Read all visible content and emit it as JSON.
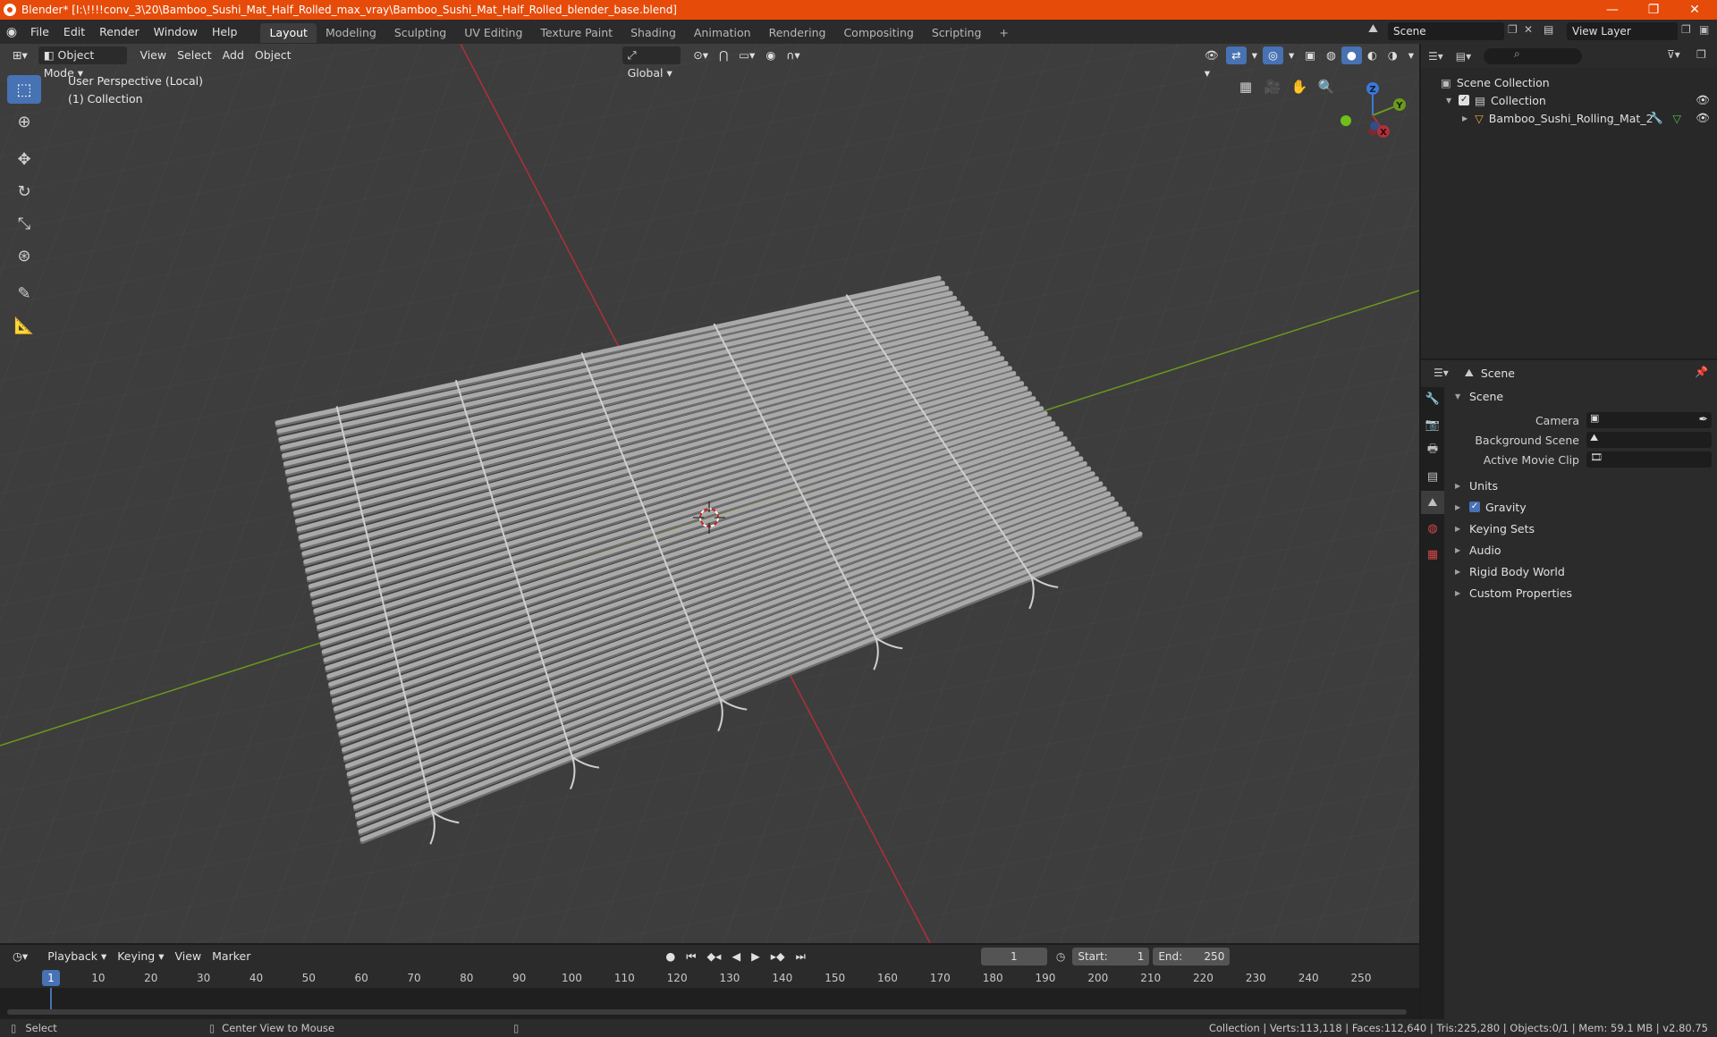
{
  "window": {
    "title": "Blender* [I:\\!!!!conv_3\\20\\Bamboo_Sushi_Mat_Half_Rolled_max_vray\\Bamboo_Sushi_Mat_Half_Rolled_blender_base.blend]",
    "controls": {
      "minimize": "—",
      "maximize": "❐",
      "close": "✕"
    }
  },
  "menu": [
    "File",
    "Edit",
    "Render",
    "Window",
    "Help"
  ],
  "workspaces": [
    "Layout",
    "Modeling",
    "Sculpting",
    "UV Editing",
    "Texture Paint",
    "Shading",
    "Animation",
    "Rendering",
    "Compositing",
    "Scripting"
  ],
  "workspace_add": "+",
  "scene_selector": {
    "value": "Scene"
  },
  "view_layer_selector": {
    "value": "View Layer"
  },
  "viewport": {
    "mode": "Object Mode",
    "menus": [
      "View",
      "Select",
      "Add",
      "Object"
    ],
    "orientation": "Global",
    "info_line1": "User Perspective (Local)",
    "info_line2": "(1) Collection",
    "gizmo_axes": {
      "x": "X",
      "y": "Y",
      "z": "Z"
    }
  },
  "outliner": {
    "search_placeholder": "",
    "scene_collection": "Scene Collection",
    "collection": "Collection",
    "object": "Bamboo_Sushi_Rolling_Mat_2"
  },
  "properties": {
    "header": "Scene",
    "panel": "Scene",
    "fields": [
      {
        "label": "Camera",
        "value": ""
      },
      {
        "label": "Background Scene",
        "value": ""
      },
      {
        "label": "Active Movie Clip",
        "value": ""
      }
    ],
    "subpanels": [
      "Units",
      "Gravity",
      "Keying Sets",
      "Audio",
      "Rigid Body World",
      "Custom Properties"
    ],
    "gravity_checked": true
  },
  "timeline": {
    "menus": [
      "Playback",
      "Keying",
      "View",
      "Marker"
    ],
    "current_frame": "1",
    "start_label": "Start:",
    "start": "1",
    "end_label": "End:",
    "end": "250",
    "ruler": [
      "1",
      "10",
      "20",
      "30",
      "40",
      "50",
      "60",
      "70",
      "80",
      "90",
      "100",
      "110",
      "120",
      "130",
      "140",
      "150",
      "160",
      "170",
      "180",
      "190",
      "200",
      "210",
      "220",
      "230",
      "240",
      "250"
    ]
  },
  "statusbar": {
    "select": "Select",
    "center": "Center View to Mouse",
    "stats": "Collection | Verts:113,118 | Faces:112,640 | Tris:225,280 | Objects:0/1 | Mem: 59.1 MB | v2.80.75"
  },
  "colors": {
    "accent": "#4772b3",
    "titlebar": "#e64b0a",
    "x_axis": "#b0303a",
    "y_axis": "#6a9a1c",
    "z_axis": "#3d78d8"
  }
}
